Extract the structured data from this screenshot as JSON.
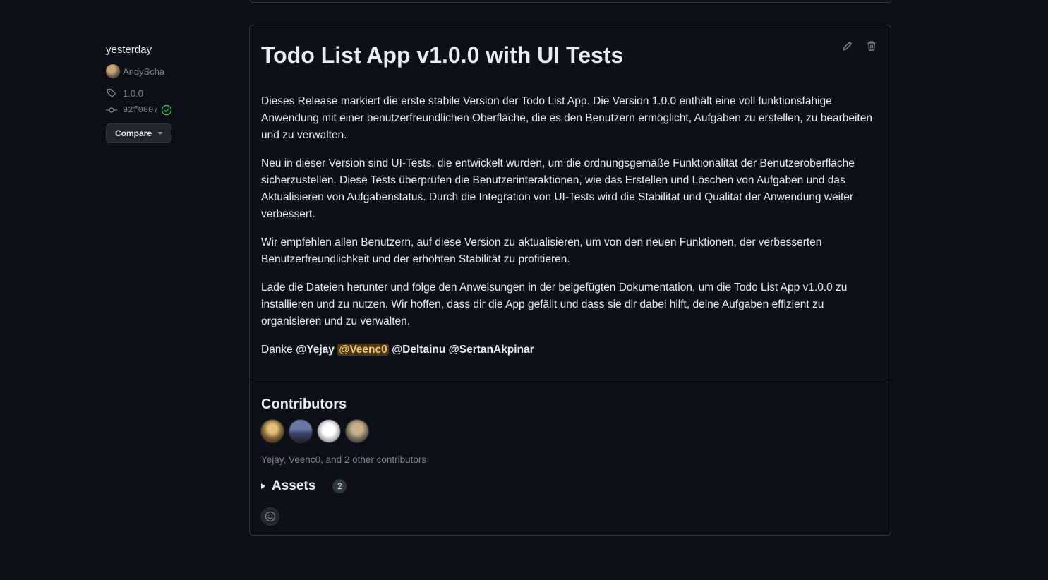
{
  "meta": {
    "date": "yesterday",
    "author": "AndyScha",
    "tag": "1.0.0",
    "commit": "92f0807",
    "compare_label": "Compare"
  },
  "release": {
    "title": "Todo List App v1.0.0 with UI Tests",
    "paragraphs": [
      "Dieses Release markiert die erste stabile Version der Todo List App. Die Version 1.0.0 enthält eine voll funktionsfähige Anwendung mit einer benutzerfreundlichen Oberfläche, die es den Benutzern ermöglicht, Aufgaben zu erstellen, zu bearbeiten und zu verwalten.",
      "Neu in dieser Version sind UI-Tests, die entwickelt wurden, um die ordnungsgemäße Funktionalität der Benutzeroberfläche sicherzustellen. Diese Tests überprüfen die Benutzerinteraktionen, wie das Erstellen und Löschen von Aufgaben und das Aktualisieren von Aufgabenstatus. Durch die Integration von UI-Tests wird die Stabilität und Qualität der Anwendung weiter verbessert.",
      "Wir empfehlen allen Benutzern, auf diese Version zu aktualisieren, um von den neuen Funktionen, der verbesserten Benutzerfreundlichkeit und der erhöhten Stabilität zu profitieren.",
      "Lade die Dateien herunter und folge den Anweisungen in der beigefügten Dokumentation, um die Todo List App v1.0.0 zu installieren und zu nutzen. Wir hoffen, dass dir die App gefällt und dass sie dir dabei hilft, deine Aufgaben effizient zu organisieren und zu verwalten."
    ],
    "thanks_prefix": "Danke",
    "mentions": [
      "@Yejay",
      "@Veenc0",
      "@Deltainu",
      "@SertanAkpinar"
    ]
  },
  "contributors": {
    "title": "Contributors",
    "summary": "Yejay, Veenc0, and 2 other contributors"
  },
  "assets": {
    "label": "Assets",
    "count": "2"
  },
  "icons": {
    "tag": "tag-icon",
    "commit": "git-commit-icon",
    "verified": "check-circle-icon",
    "edit": "pencil-icon",
    "delete": "trash-icon",
    "reaction": "smiley-icon"
  },
  "colors": {
    "background": "#0d1117",
    "border": "#30363d",
    "text": "#e6edf3",
    "muted": "#7d8590",
    "verified": "#3fb950",
    "mention_highlight": "#bb8009"
  }
}
